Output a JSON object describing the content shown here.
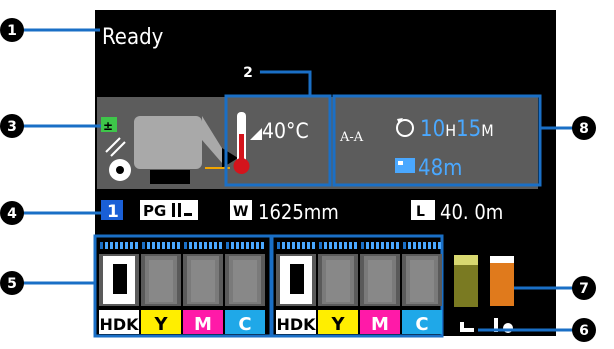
{
  "status": {
    "text": "Ready"
  },
  "temperature": {
    "value": "40",
    "unit": "°C"
  },
  "pg_label": "PG",
  "tray": {
    "number": "1"
  },
  "media": {
    "width_badge": "W",
    "width_value": "1625mm",
    "length_badge": "L",
    "length_value": "40. 0m"
  },
  "timer": {
    "mode": "A-A",
    "time_h": "10",
    "time_h_unit": "H",
    "time_m": "15",
    "time_m_unit": "M",
    "distance": "48m"
  },
  "ink_groups": [
    {
      "labels": [
        "HDK",
        "Y",
        "M",
        "C"
      ]
    },
    {
      "labels": [
        "HDK",
        "Y",
        "M",
        "C"
      ]
    }
  ],
  "callouts": [
    "1",
    "2",
    "3",
    "4",
    "5",
    "6",
    "7",
    "8"
  ],
  "colors": {
    "screen": "#000000",
    "panel": "#5c5c5c",
    "cartridge": "#a9a9a9",
    "callout_line": "#1a6fc6",
    "accent_text": "#4aa8ff",
    "yellow": "#ffee00",
    "magenta": "#ff1aa8",
    "cyan": "#1fa8e8",
    "thermo_red": "#d4141c",
    "maintenance_orange": "#e07a1c",
    "waste_olive": "#7a7a22",
    "tray_blue": "#1a5fd6"
  },
  "icons": {
    "plus_minus": "plus-minus-icon",
    "roll": "media-roll-icon",
    "thermometer": "thermometer-icon",
    "refresh": "refresh-icon",
    "distance": "distance-icon",
    "waste_bottle": "waste-bottle-icon",
    "maintenance": "maintenance-tool-icon"
  }
}
